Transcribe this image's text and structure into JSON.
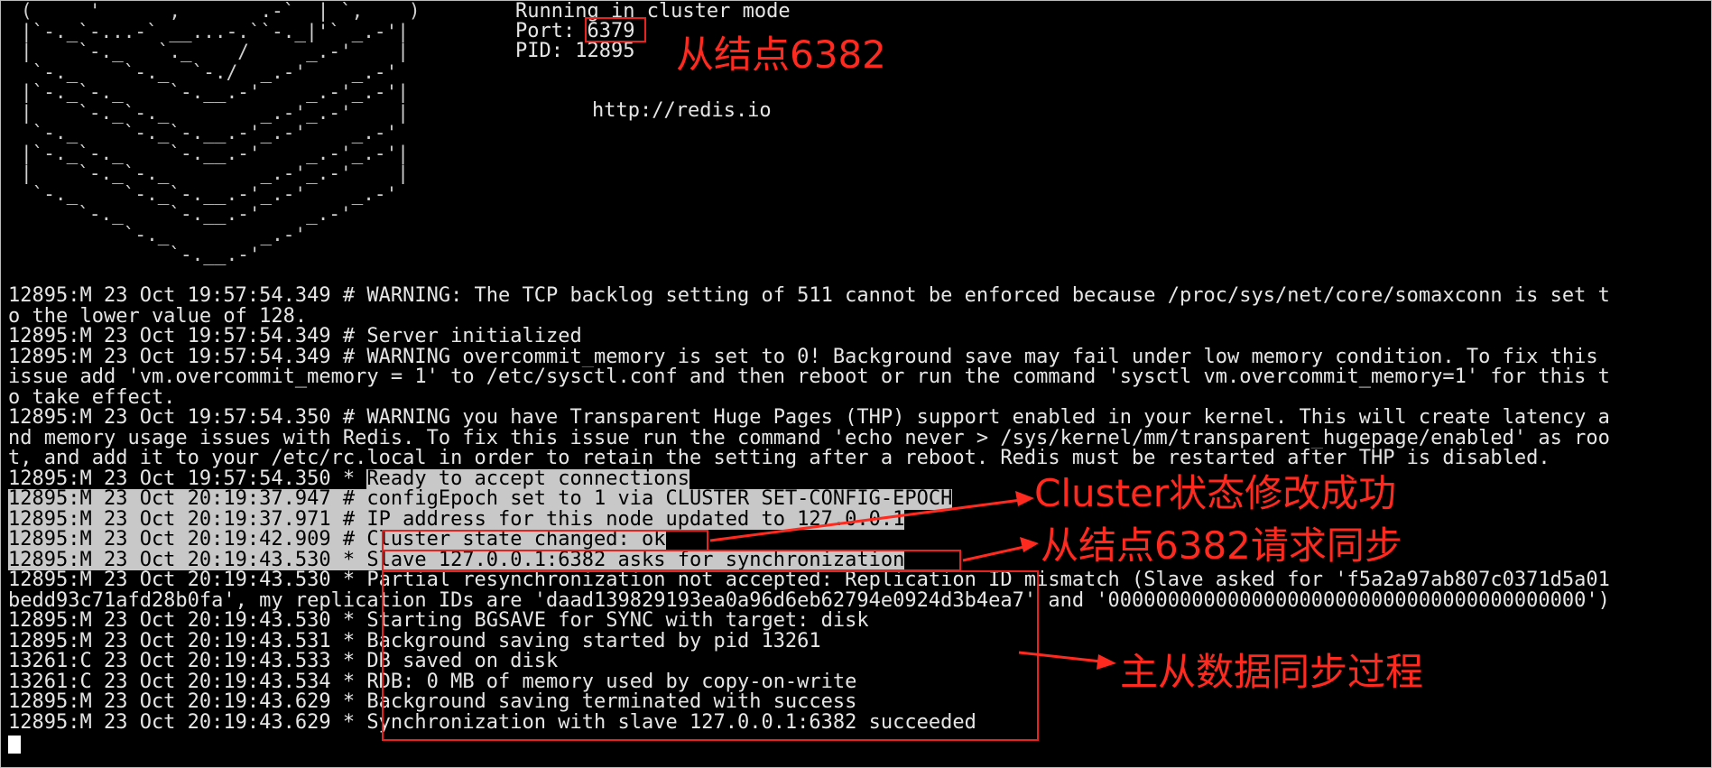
{
  "logo_lines": [
    "(     '      ,       .-`  | `,    )",
    "|`-._`-...-` __...-.``-._|'` _.-'|",
    "|    `-._   `._    /     _.-'    |",
    " `-._    `-._  `-./  _.-'    _.-'",
    "|`-._`-._    `-.__.-'    _.-'_.-'|",
    "|    `-._`-._        _.-'_.-'    |",
    " `-._    `-._`-.__.-'_.-'    _.-'",
    "|`-._`-._    `-.__.-'    _.-'_.-'|",
    "|    `-._`-._        _.-'_.-'    |",
    " `-._    `-._`-.__.-'_.-'    _.-'",
    "     `-._    `-.__.-'    _.-'",
    "         `-._        _.-'",
    "             `-.__.-'"
  ],
  "info": {
    "mode": "Running in cluster mode",
    "port_label": "Port: ",
    "port_value": "6379",
    "pid": "PID: 12895",
    "url": "http://redis.io"
  },
  "log_lines": [
    {
      "text": "12895:M 23 Oct 19:57:54.349 # WARNING: The TCP backlog setting of 511 cannot be enforced because /proc/sys/net/core/somaxconn is set t",
      "hl": ""
    },
    {
      "text": "o the lower value of 128.",
      "hl": ""
    },
    {
      "text": "12895:M 23 Oct 19:57:54.349 # Server initialized",
      "hl": ""
    },
    {
      "text": "12895:M 23 Oct 19:57:54.349 # WARNING overcommit_memory is set to 0! Background save may fail under low memory condition. To fix this",
      "hl": ""
    },
    {
      "text": "issue add 'vm.overcommit_memory = 1' to /etc/sysctl.conf and then reboot or run the command 'sysctl vm.overcommit_memory=1' for this t",
      "hl": ""
    },
    {
      "text": "o take effect.",
      "hl": ""
    },
    {
      "text": "12895:M 23 Oct 19:57:54.350 # WARNING you have Transparent Huge Pages (THP) support enabled in your kernel. This will create latency a",
      "hl": ""
    },
    {
      "text": "nd memory usage issues with Redis. To fix this issue run the command 'echo never > /sys/kernel/mm/transparent_hugepage/enabled' as roo",
      "hl": ""
    },
    {
      "text": "t, and add it to your /etc/rc.local in order to retain the setting after a reboot. Redis must be restarted after THP is disabled.",
      "hl": ""
    },
    {
      "prefix": "12895:M 23 Oct 19:57:54.350 * ",
      "text": "Ready to accept connections",
      "hl": "msg"
    },
    {
      "prefix": "12895:M 23 Oct 20:19:37.947 # ",
      "text": "configEpoch set to 1 via CLUSTER SET-CONFIG-EPOCH",
      "hl": "full"
    },
    {
      "prefix": "12895:M 23 Oct 20:19:37.971 # ",
      "text": "IP address for this node updated to 127.0.0.1",
      "hl": "full"
    },
    {
      "prefix": "12895:M 23 Oct 20:19:42.909 # ",
      "text": "Cluster state changed: ok",
      "hl": "full"
    },
    {
      "prefix": "12895:M 23 Oct 20:19:43.530 * ",
      "text": "Slave 127.0.0.1:6382 asks for synchronization",
      "hl": "full"
    },
    {
      "text": "12895:M 23 Oct 20:19:43.530 * Partial resynchronization not accepted: Replication ID mismatch (Slave asked for 'f5a2a97ab807c0371d5a01",
      "hl": ""
    },
    {
      "text": "bedd93c71afd28b0fa', my replication IDs are 'daad139829193ea0a96d6eb62794e0924d3b4ea7' and '0000000000000000000000000000000000000000')",
      "hl": ""
    },
    {
      "text": "12895:M 23 Oct 20:19:43.530 * Starting BGSAVE for SYNC with target: disk",
      "hl": ""
    },
    {
      "text": "12895:M 23 Oct 20:19:43.531 * Background saving started by pid 13261",
      "hl": ""
    },
    {
      "text": "13261:C 23 Oct 20:19:43.533 * DB saved on disk",
      "hl": ""
    },
    {
      "text": "13261:C 23 Oct 20:19:43.534 * RDB: 0 MB of memory used by copy-on-write",
      "hl": ""
    },
    {
      "text": "12895:M 23 Oct 20:19:43.629 * Background saving terminated with success",
      "hl": ""
    },
    {
      "text": "12895:M 23 Oct 20:19:43.629 * Synchronization with slave 127.0.0.1:6382 succeeded",
      "hl": ""
    }
  ],
  "annotations": {
    "slave_node": "从结点6382",
    "cluster_ok": "Cluster状态修改成功",
    "sync_request": "从结点6382请求同步",
    "sync_process": "主从数据同步过程"
  },
  "colors": {
    "annotation": "#ff2a1f",
    "highlight": "#c8c8c8",
    "background": "#000000"
  }
}
